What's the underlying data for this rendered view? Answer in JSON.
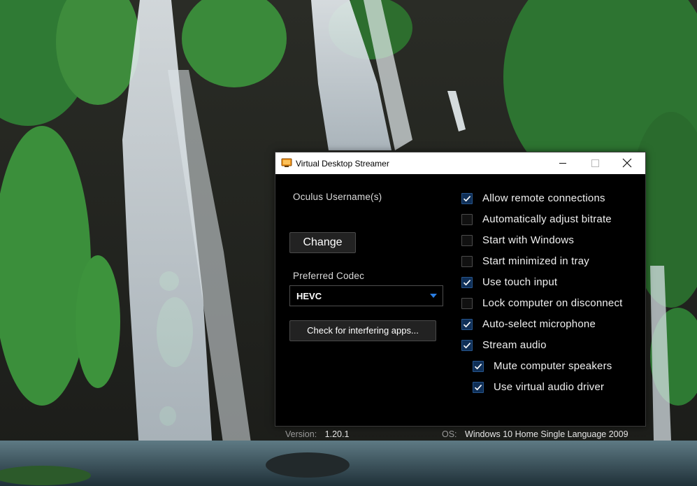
{
  "window": {
    "title": "Virtual Desktop Streamer",
    "icon": "app-monitor-icon"
  },
  "left": {
    "username_label": "Oculus Username(s)",
    "change_button": "Change",
    "codec_label": "Preferred Codec",
    "codec_value": "HEVC",
    "check_button": "Check for interfering apps..."
  },
  "options": [
    {
      "label": "Allow remote connections",
      "checked": true
    },
    {
      "label": "Automatically adjust bitrate",
      "checked": false
    },
    {
      "label": "Start with Windows",
      "checked": false
    },
    {
      "label": "Start minimized in tray",
      "checked": false
    },
    {
      "label": "Use touch input",
      "checked": true
    },
    {
      "label": "Lock computer on disconnect",
      "checked": false
    },
    {
      "label": "Auto-select microphone",
      "checked": true
    },
    {
      "label": "Stream audio",
      "checked": true
    },
    {
      "label": "Mute computer speakers",
      "checked": true
    },
    {
      "label": "Use virtual audio driver",
      "checked": true
    }
  ],
  "footer": {
    "version_label": "Version:",
    "version_value": "1.20.1",
    "os_label": "OS:",
    "os_value": "Windows 10 Home Single Language 2009"
  },
  "colors": {
    "window_bg": "#000000",
    "accent": "#2a7de1",
    "check_bg": "#0f2f57"
  }
}
